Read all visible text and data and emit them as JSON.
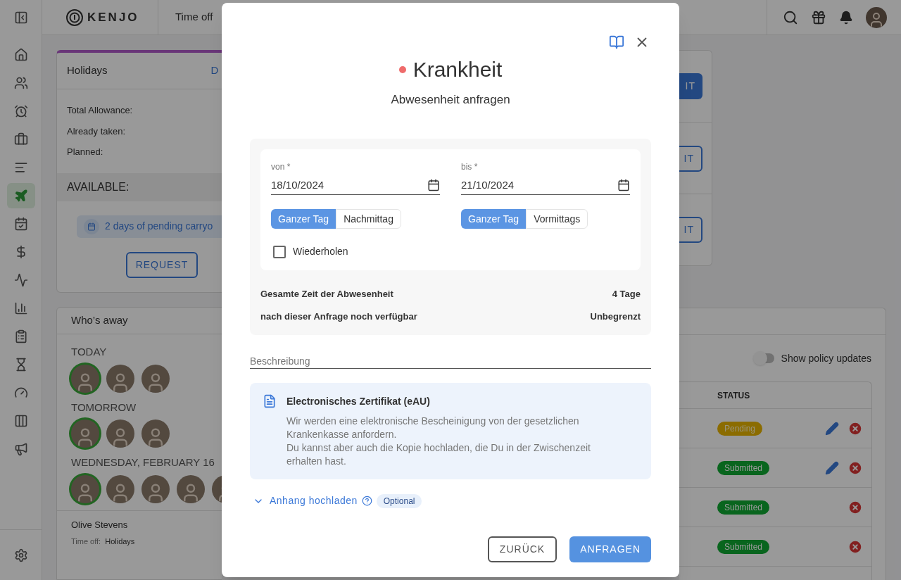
{
  "topbar": {
    "logo": "KENJO",
    "section": "Time off"
  },
  "sidebar": {
    "items": [
      {
        "selected": false
      },
      {
        "selected": false
      },
      {
        "selected": false
      },
      {
        "selected": false
      },
      {
        "selected": false
      },
      {
        "selected": true
      },
      {
        "selected": false
      },
      {
        "selected": false
      },
      {
        "selected": false
      },
      {
        "selected": false
      },
      {
        "selected": false
      },
      {
        "selected": false
      },
      {
        "selected": false
      },
      {
        "selected": false
      },
      {
        "selected": false
      }
    ]
  },
  "holidays_card": {
    "title": "Holidays",
    "link": "D",
    "rows": [
      "Total Allowance:",
      "Already taken:",
      "Planned:"
    ],
    "available": "AVAILABLE:",
    "carryover": "2 days of pending carryo",
    "button": "REQUEST"
  },
  "whos_away": {
    "title": "Who’s away",
    "groups": [
      {
        "label": "TODAY",
        "avatars": [
          {
            "highlighted": true
          },
          {
            "highlighted": false
          },
          {
            "highlighted": false
          }
        ]
      },
      {
        "label": "TOMORROW",
        "avatars": [
          {
            "highlighted": true
          },
          {
            "highlighted": false
          },
          {
            "highlighted": false
          }
        ]
      },
      {
        "label": "WEDNESDAY, FEBRUARY 16",
        "avatars": [
          {
            "highlighted": true
          },
          {
            "highlighted": false
          },
          {
            "highlighted": false
          },
          {
            "highlighted": false
          },
          {
            "highlighted": false
          }
        ]
      }
    ],
    "person": {
      "name": "Olive Stevens",
      "label": "Time off:",
      "value": "Holidays"
    }
  },
  "policy_card": {
    "buttons": [
      {
        "label": "IT",
        "primary": true
      },
      {
        "label": "IT",
        "primary": false
      },
      {
        "label": "IT",
        "primary": false
      }
    ]
  },
  "requests": {
    "toggle": {
      "label": "Show policy updates",
      "on": false
    },
    "columns": [
      "STATUS"
    ],
    "rows": [
      {
        "status": "Pending",
        "kind": "pending",
        "editable": true
      },
      {
        "status": "Submitted",
        "kind": "submitted",
        "editable": true
      },
      {
        "status": "Submitted",
        "kind": "submitted",
        "editable": false
      },
      {
        "status": "Submitted",
        "kind": "submitted",
        "editable": false
      }
    ]
  },
  "modal": {
    "title": "Krankheit",
    "color": "#ef6b6b",
    "subtitle": "Abwesenheit anfragen",
    "dates": [
      {
        "label": "von *",
        "value": "18/10/2024",
        "options": [
          {
            "label": "Ganzer Tag",
            "selected": true
          },
          {
            "label": "Nachmittag",
            "selected": false
          }
        ]
      },
      {
        "label": "bis *",
        "value": "21/10/2024",
        "options": [
          {
            "label": "Ganzer Tag",
            "selected": true
          },
          {
            "label": "Vormittags",
            "selected": false
          }
        ]
      }
    ],
    "repeat": {
      "label": "Wiederholen",
      "checked": false
    },
    "summary": [
      {
        "label": "Gesamte Zeit der Abwesenheit",
        "value": "4 Tage"
      },
      {
        "label": "nach dieser Anfrage noch verfügbar",
        "value": "Unbegrenzt"
      }
    ],
    "description": {
      "placeholder": "Beschreibung"
    },
    "info": {
      "title": "Electronisches Zertifikat (eAU)",
      "paragraphs": [
        "Wir werden eine elektronische Bescheinigung von der gesetzlichen Krankenkasse anfordern.",
        "Du kannst aber auch die Kopie hochladen, die Du in der Zwischenzeit erhalten hast."
      ]
    },
    "attachment": {
      "label": "Anhang hochladen",
      "expanded": false,
      "badge": "Optional"
    },
    "buttons": [
      {
        "label": "ZURÜCK",
        "primary": false
      },
      {
        "label": "ANFRAGEN",
        "primary": true
      }
    ]
  }
}
